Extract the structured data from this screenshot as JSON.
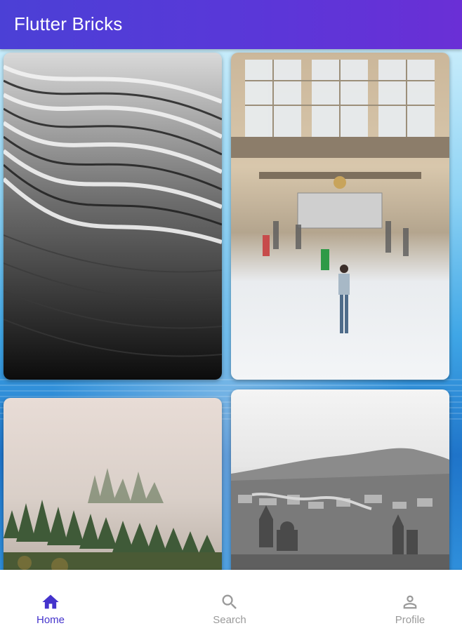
{
  "app_bar": {
    "title": "Flutter Bricks"
  },
  "grid": {
    "items": [
      {
        "subject": "black and white wavy architecture facade"
      },
      {
        "subject": "train station hall with people"
      },
      {
        "subject": "misty pine forest"
      },
      {
        "subject": "black and white city panorama with hills"
      }
    ]
  },
  "bottom_nav": {
    "items": [
      {
        "label": "Home",
        "icon": "home-icon",
        "active": true
      },
      {
        "label": "Search",
        "icon": "search-icon",
        "active": false
      },
      {
        "label": "Profile",
        "icon": "person-icon",
        "active": false
      }
    ]
  },
  "colors": {
    "app_bar_start": "#4b40d6",
    "app_bar_end": "#6a2fd6",
    "nav_active": "#4433cc",
    "nav_inactive": "#9a9a9a"
  }
}
